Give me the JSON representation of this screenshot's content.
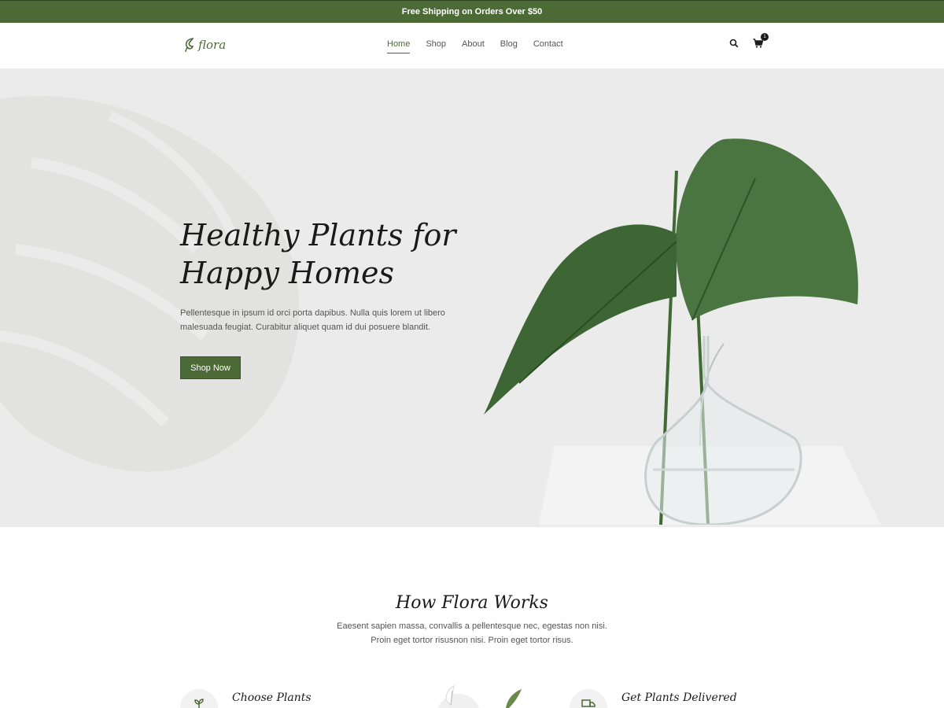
{
  "topbar": {
    "text": "Free Shipping on Orders Over $50"
  },
  "brand": {
    "name": "flora",
    "color": "#4c6a35"
  },
  "nav": {
    "items": [
      {
        "label": "Home",
        "active": true
      },
      {
        "label": "Shop",
        "active": false
      },
      {
        "label": "About",
        "active": false
      },
      {
        "label": "Blog",
        "active": false
      },
      {
        "label": "Contact",
        "active": false
      }
    ],
    "search_icon": "search-icon",
    "cart_icon": "cart-icon",
    "cart_count": "1"
  },
  "hero": {
    "title_line1": "Healthy Plants for",
    "title_line2": "Happy Homes",
    "description": "Pellentesque in ipsum id orci porta dapibus. Nulla quis lorem ut libero malesuada feugiat. Curabitur aliquet quam id dui posuere blandit.",
    "button_label": "Shop Now"
  },
  "works": {
    "title": "How Flora Works",
    "description": "Eaesent sapien massa, convallis a pellentesque nec, egestas non nisi. Proin eget tortor risusnon nisi. Proin eget tortor risus.",
    "steps": [
      {
        "title": "Choose Plants",
        "icon": "sprout-icon"
      },
      {
        "title": "Get Plants Delivered",
        "icon": "truck-icon"
      }
    ]
  }
}
